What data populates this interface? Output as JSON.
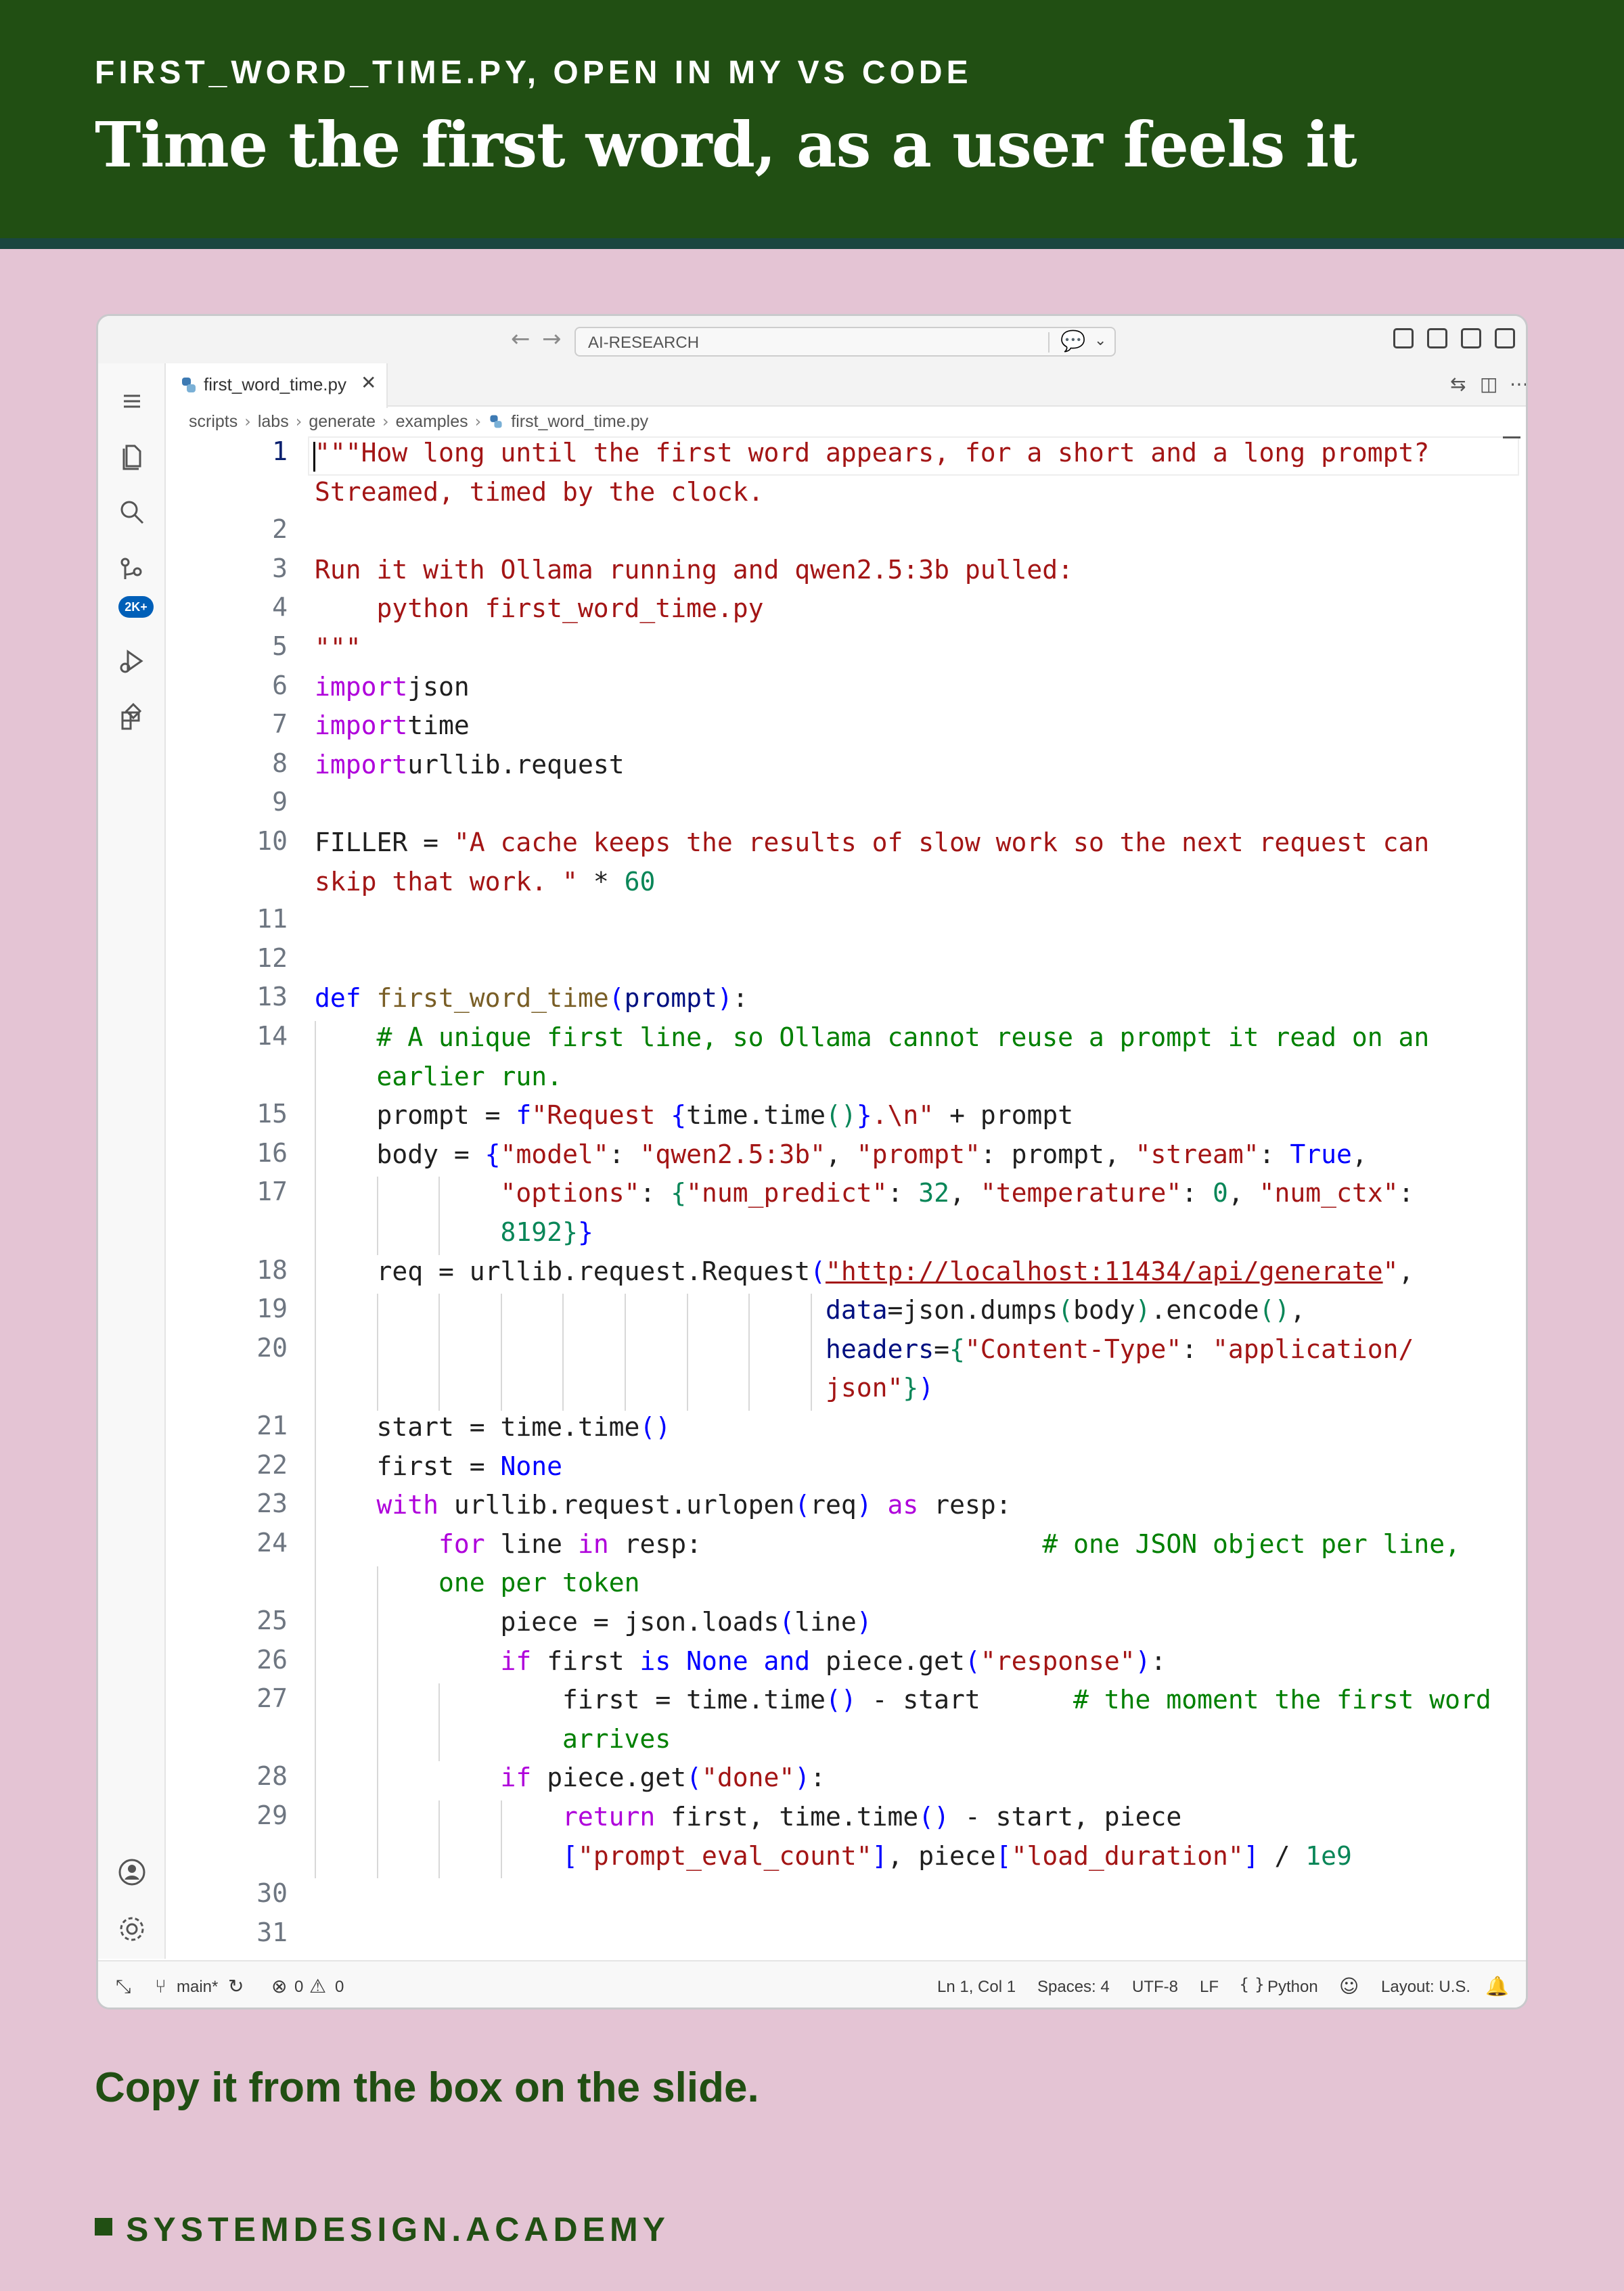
{
  "slide": {
    "kicker": "FIRST_WORD_TIME.PY, OPEN IN MY VS CODE",
    "headline": "Time the first word, as a user feels it",
    "caption": "Copy it from the box on the slide.",
    "brand": "SYSTEMDESIGN.ACADEMY"
  },
  "titlebar": {
    "search_text": "AI-RESEARCH"
  },
  "activity": {
    "source_control_badge": "2K+"
  },
  "tab": {
    "label": "first_word_time.py"
  },
  "breadcrumb": [
    "scripts",
    "labs",
    "generate",
    "examples",
    "first_word_time.py"
  ],
  "editor": {
    "line_numbers": [
      "1",
      "2",
      "3",
      "4",
      "5",
      "6",
      "7",
      "8",
      "9",
      "10",
      "11",
      "12",
      "13",
      "14",
      "15",
      "16",
      "17",
      "18",
      "19",
      "20",
      "21",
      "22",
      "23",
      "24",
      "25",
      "26",
      "27",
      "28",
      "29",
      "30",
      "31"
    ],
    "active_line": "1"
  },
  "code": [
    [
      [
        "str",
        "\"\"\"How long until the first word appears, for a short and a long prompt?"
      ]
    ],
    [
      [
        "str",
        "Streamed, timed by the clock."
      ]
    ],
    [],
    [
      [
        "str",
        "Run it with Ollama running and qwen2.5:3b pulled:"
      ]
    ],
    [
      [
        "str",
        "    python first_word_time.py"
      ]
    ],
    [
      [
        "str",
        "\"\"\""
      ]
    ],
    [
      [
        "kw",
        "import"
      ],
      [
        "",
        "json"
      ]
    ],
    [
      [
        "kw",
        "import"
      ],
      [
        "",
        "time"
      ]
    ],
    [
      [
        "kw",
        "import"
      ],
      [
        "",
        "urllib.request"
      ]
    ],
    [],
    [
      [
        "",
        "FILLER = "
      ],
      [
        "str",
        "\"A cache keeps the results of slow work so the next request can"
      ]
    ],
    [
      [
        "str",
        "skip that work. \""
      ],
      [
        "",
        " * "
      ],
      [
        "num",
        "60"
      ]
    ],
    [],
    [],
    [
      [
        "blue",
        "def"
      ],
      [
        "",
        " "
      ],
      [
        "fn",
        "first_word_time"
      ],
      [
        "blue",
        "("
      ],
      [
        "var",
        "prompt"
      ],
      [
        "blue",
        ")"
      ],
      [
        "",
        ":"
      ]
    ],
    [
      [
        "",
        "    "
      ],
      [
        "cm",
        "# A unique first line, so Ollama cannot reuse a prompt it read on an"
      ]
    ],
    [
      [
        "",
        "    "
      ],
      [
        "cm",
        "earlier run."
      ]
    ],
    [
      [
        "",
        "    prompt = "
      ],
      [
        "blue",
        "f"
      ],
      [
        "str",
        "\"Request "
      ],
      [
        "blue",
        "{"
      ],
      [
        "",
        "time.time"
      ],
      [
        "num",
        "()"
      ],
      [
        "blue",
        "}"
      ],
      [
        "str",
        ".\\n\""
      ],
      [
        "",
        " + prompt"
      ]
    ],
    [
      [
        "",
        "    body = "
      ],
      [
        "blue",
        "{"
      ],
      [
        "str",
        "\"model\""
      ],
      [
        "",
        ": "
      ],
      [
        "str",
        "\"qwen2.5:3b\""
      ],
      [
        "",
        ", "
      ],
      [
        "str",
        "\"prompt\""
      ],
      [
        "",
        ": prompt, "
      ],
      [
        "str",
        "\"stream\""
      ],
      [
        "",
        ": "
      ],
      [
        "blue",
        "True"
      ],
      [
        "",
        ","
      ]
    ],
    [
      [
        "",
        "            "
      ],
      [
        "str",
        "\"options\""
      ],
      [
        "",
        ": "
      ],
      [
        "num",
        "{"
      ],
      [
        "str",
        "\"num_predict\""
      ],
      [
        "",
        ": "
      ],
      [
        "num",
        "32"
      ],
      [
        "",
        ", "
      ],
      [
        "str",
        "\"temperature\""
      ],
      [
        "",
        ": "
      ],
      [
        "num",
        "0"
      ],
      [
        "",
        ", "
      ],
      [
        "str",
        "\"num_ctx\""
      ],
      [
        "",
        ":"
      ]
    ],
    [
      [
        "",
        "            "
      ],
      [
        "num",
        "8192"
      ],
      [
        "num",
        "}"
      ],
      [
        "blue",
        "}"
      ]
    ],
    [
      [
        "",
        "    req = urllib.request.Request"
      ],
      [
        "blue",
        "("
      ],
      [
        "str url",
        "\"http://localhost:11434/api/generate"
      ],
      [
        "str",
        "\""
      ],
      [
        "",
        ","
      ]
    ],
    [
      [
        "",
        "                                 "
      ],
      [
        "var",
        "data"
      ],
      [
        "",
        "=json.dumps"
      ],
      [
        "num",
        "("
      ],
      [
        "",
        "body"
      ],
      [
        "num",
        ")"
      ],
      [
        "",
        ".encode"
      ],
      [
        "num",
        "()"
      ],
      [
        "",
        ","
      ]
    ],
    [
      [
        "",
        "                                 "
      ],
      [
        "var",
        "headers"
      ],
      [
        "",
        "="
      ],
      [
        "num",
        "{"
      ],
      [
        "str",
        "\"Content-Type\""
      ],
      [
        "",
        ": "
      ],
      [
        "str",
        "\"application/"
      ]
    ],
    [
      [
        "",
        "                                 "
      ],
      [
        "str",
        "json\""
      ],
      [
        "num",
        "}"
      ],
      [
        "blue",
        ")"
      ]
    ],
    [
      [
        "",
        "    start = time.time"
      ],
      [
        "blue",
        "()"
      ]
    ],
    [
      [
        "",
        "    first = "
      ],
      [
        "blue",
        "None"
      ]
    ],
    [
      [
        "",
        "    "
      ],
      [
        "kw",
        "with"
      ],
      [
        "",
        " urllib.request.urlopen"
      ],
      [
        "blue",
        "("
      ],
      [
        "",
        "req"
      ],
      [
        "blue",
        ")"
      ],
      [
        "",
        " "
      ],
      [
        "kw",
        "as"
      ],
      [
        "",
        " resp:"
      ]
    ],
    [
      [
        "",
        "        "
      ],
      [
        "kw",
        "for"
      ],
      [
        "",
        " line "
      ],
      [
        "kw",
        "in"
      ],
      [
        "",
        " resp:                      "
      ],
      [
        "cm",
        "# one JSON object per line,"
      ]
    ],
    [
      [
        "",
        "        "
      ],
      [
        "cm",
        "one per token"
      ]
    ],
    [
      [
        "",
        "            piece = json.loads"
      ],
      [
        "blue",
        "("
      ],
      [
        "",
        "line"
      ],
      [
        "blue",
        ")"
      ]
    ],
    [
      [
        "",
        "            "
      ],
      [
        "kw",
        "if"
      ],
      [
        "",
        " first "
      ],
      [
        "blue",
        "is None and"
      ],
      [
        "",
        " piece.get"
      ],
      [
        "blue",
        "("
      ],
      [
        "str",
        "\"response\""
      ],
      [
        "blue",
        ")"
      ],
      [
        "",
        ":"
      ]
    ],
    [
      [
        "",
        "                first = time.time"
      ],
      [
        "blue",
        "()"
      ],
      [
        "",
        " - start      "
      ],
      [
        "cm",
        "# the moment the first word"
      ]
    ],
    [
      [
        "",
        "                "
      ],
      [
        "cm",
        "arrives"
      ]
    ],
    [
      [
        "",
        "            "
      ],
      [
        "kw",
        "if"
      ],
      [
        "",
        " piece.get"
      ],
      [
        "blue",
        "("
      ],
      [
        "str",
        "\"done\""
      ],
      [
        "blue",
        ")"
      ],
      [
        "",
        ":"
      ]
    ],
    [
      [
        "",
        "                "
      ],
      [
        "kw",
        "return"
      ],
      [
        "",
        " first, time.time"
      ],
      [
        "blue",
        "()"
      ],
      [
        "",
        " - start, piece"
      ]
    ],
    [
      [
        "",
        "                "
      ],
      [
        "blue",
        "["
      ],
      [
        "str",
        "\"prompt_eval_count\""
      ],
      [
        "blue",
        "]"
      ],
      [
        "",
        ", piece"
      ],
      [
        "blue",
        "["
      ],
      [
        "str",
        "\"load_duration\""
      ],
      [
        "blue",
        "]"
      ],
      [
        "",
        " / "
      ],
      [
        "num",
        "1e9"
      ]
    ],
    [],
    []
  ],
  "statusbar": {
    "branch": "main*",
    "errors": "0",
    "warnings": "0",
    "position": "Ln 1, Col 1",
    "spaces": "Spaces: 4",
    "encoding": "UTF-8",
    "eol": "LF",
    "language": "Python",
    "layout": "Layout: U.S."
  }
}
